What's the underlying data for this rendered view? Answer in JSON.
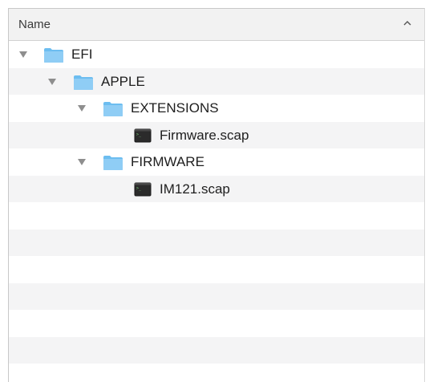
{
  "header": {
    "column_name": "Name",
    "sort_icon": "chevron-up-icon"
  },
  "tree": [
    {
      "label": "EFI",
      "kind": "folder",
      "depth": 0,
      "expanded": true
    },
    {
      "label": "APPLE",
      "kind": "folder",
      "depth": 1,
      "expanded": true
    },
    {
      "label": "EXTENSIONS",
      "kind": "folder",
      "depth": 2,
      "expanded": true
    },
    {
      "label": "Firmware.scap",
      "kind": "file",
      "depth": 3
    },
    {
      "label": "FIRMWARE",
      "kind": "folder",
      "depth": 2,
      "expanded": true
    },
    {
      "label": "IM121.scap",
      "kind": "file",
      "depth": 3
    }
  ],
  "colors": {
    "folder": "#6cbdf0",
    "folder_tab": "#8fcdf5",
    "file": "#2b2b2b",
    "alt_row": "#f4f4f5"
  }
}
